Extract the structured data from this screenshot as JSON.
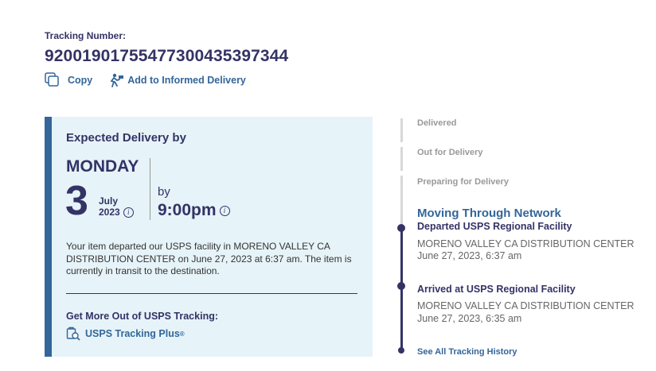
{
  "tracking": {
    "label": "Tracking Number:",
    "number": "9200190175547730043539734​4"
  },
  "actions": {
    "copy": "Copy",
    "informed": "Add to Informed Delivery"
  },
  "expected": {
    "title": "Expected Delivery by",
    "day": "MONDAY",
    "date_num": "3",
    "month": "July",
    "year": "2023",
    "by": "by",
    "time": "9:00pm",
    "description": "Your item departed our USPS facility in MORENO VALLEY CA DISTRIBUTION CENTER on June 27, 2023 at 6:37 am. The item is currently in transit to the destination.",
    "more_title": "Get More Out of USPS Tracking:",
    "plus_label": "USPS Tracking Plus",
    "plus_reg": "®"
  },
  "timeline": {
    "steps": [
      "Delivered",
      "Out for Delivery",
      "Preparing for Delivery"
    ],
    "current": "Moving Through Network",
    "events": [
      {
        "title": "Departed USPS Regional Facility",
        "location": "MORENO VALLEY CA DISTRIBUTION CENTER",
        "date": "June 27, 2023, 6:37 am"
      },
      {
        "title": "Arrived at USPS Regional Facility",
        "location": "MORENO VALLEY CA DISTRIBUTION CENTER",
        "date": "June 27, 2023, 6:35 am"
      }
    ],
    "see_all": "See All Tracking History"
  },
  "colors": {
    "navy": "#333366",
    "link_blue": "#336699",
    "card_bg": "#e6f3f8"
  },
  "icons": [
    "copy-icon",
    "informed-delivery-icon",
    "info-icon",
    "tracking-plus-icon"
  ]
}
